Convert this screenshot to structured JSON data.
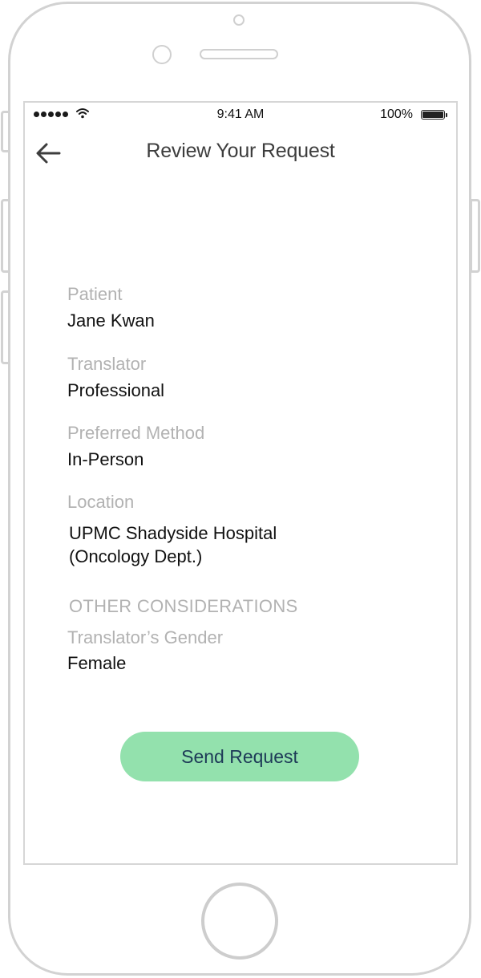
{
  "status_bar": {
    "time": "9:41 AM",
    "battery_percent": "100%",
    "battery_level": 1.0,
    "signal_bars": 5
  },
  "header": {
    "title": "Review Your Request",
    "back_icon": "arrow-left-icon"
  },
  "fields": {
    "patient": {
      "label": "Patient",
      "value": "Jane Kwan"
    },
    "translator": {
      "label": "Translator",
      "value": "Professional"
    },
    "method": {
      "label": "Preferred Method",
      "value": "In-Person"
    },
    "location": {
      "label": "Location",
      "value_line1": "UPMC Shadyside Hospital",
      "value_line2": "(Oncology Dept.)"
    }
  },
  "other": {
    "heading": "OTHER CONSIDERATIONS",
    "gender_label": "Translator’s Gender",
    "gender_value": "Female"
  },
  "actions": {
    "send_label": "Send Request"
  },
  "colors": {
    "button_bg": "#93e1ad",
    "button_text": "#1d3a57",
    "label": "#b2b2b2",
    "title": "#3d3d3d"
  }
}
